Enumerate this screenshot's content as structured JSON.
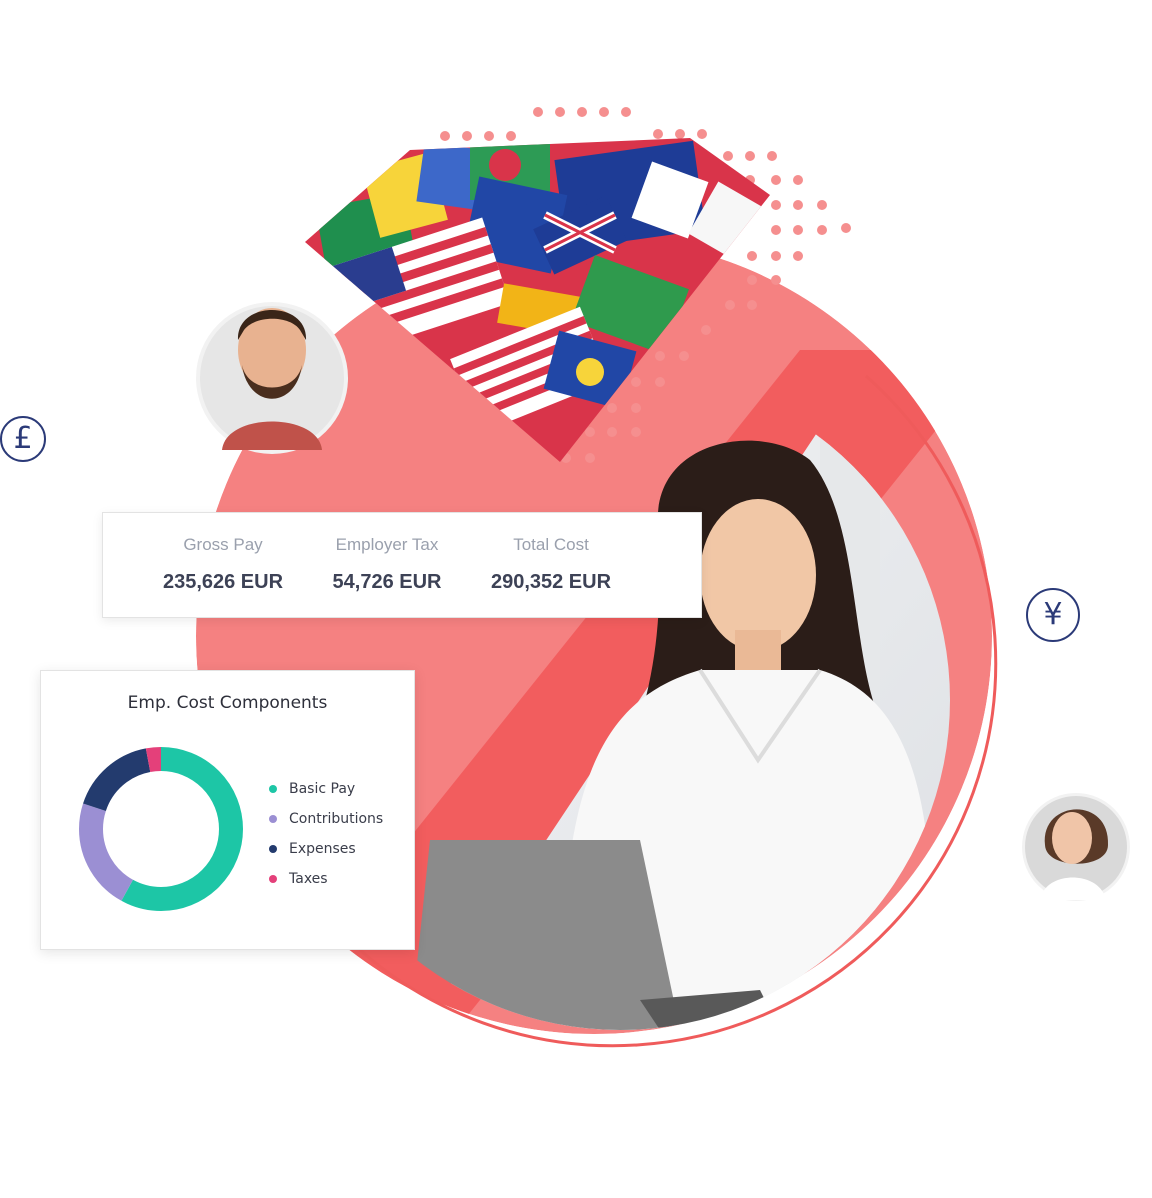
{
  "colors": {
    "accent_red": "#f26a6a",
    "navy": "#2b3a78",
    "teal": "#1dc6a6",
    "purple": "#9b8fd3",
    "dark_navy": "#233b6e",
    "pink": "#e4407a"
  },
  "icons": {
    "pound": "£",
    "yen": "¥"
  },
  "summary": {
    "gross_pay_label": "Gross Pay",
    "gross_pay_value": "235,626 EUR",
    "employer_tax_label": "Employer Tax",
    "employer_tax_value": "54,726 EUR",
    "total_cost_label": "Total Cost",
    "total_cost_value": "290,352 EUR"
  },
  "components": {
    "title": "Emp. Cost Components",
    "legend": [
      {
        "label": "Basic Pay",
        "color": "#1dc6a6"
      },
      {
        "label": "Contributions",
        "color": "#9b8fd3"
      },
      {
        "label": "Expenses",
        "color": "#233b6e"
      },
      {
        "label": "Taxes",
        "color": "#e4407a"
      }
    ]
  },
  "chart_data": {
    "type": "pie",
    "title": "Emp. Cost Components",
    "categories": [
      "Basic Pay",
      "Contributions",
      "Expenses",
      "Taxes"
    ],
    "values": [
      58,
      22,
      17,
      3
    ],
    "colors": [
      "#1dc6a6",
      "#9b8fd3",
      "#233b6e",
      "#e4407a"
    ]
  }
}
